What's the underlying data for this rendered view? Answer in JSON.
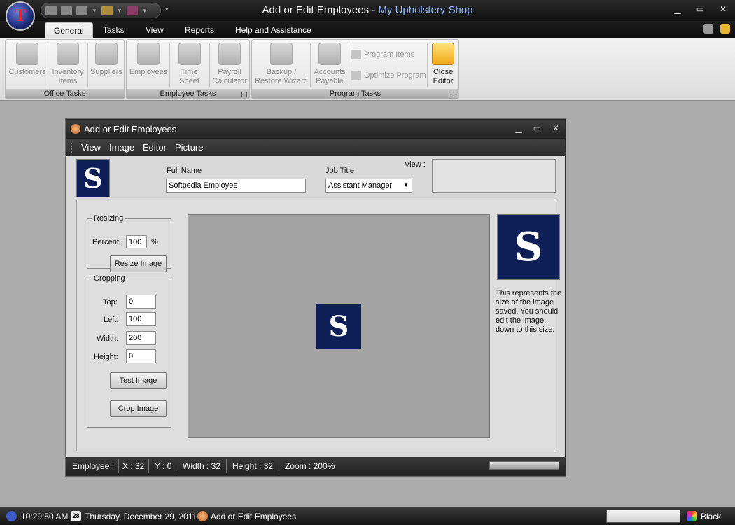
{
  "window": {
    "title_main": "Add or Edit Employees - ",
    "title_app": "My Upholstery Shop",
    "orb_letter": "T"
  },
  "tabs": [
    "General",
    "Tasks",
    "View",
    "Reports",
    "Help and Assistance"
  ],
  "ribbon": {
    "office_tasks": {
      "label": "Office Tasks",
      "customers": "Customers",
      "inventory_l1": "Inventory",
      "inventory_l2": "Items",
      "suppliers": "Suppliers"
    },
    "employee_tasks": {
      "label": "Employee Tasks",
      "employees": "Employees",
      "time_sheet": "Time Sheet",
      "payroll_l1": "Payroll",
      "payroll_l2": "Calculator"
    },
    "program_tasks": {
      "label": "Program Tasks",
      "backup_l1": "Backup /",
      "backup_l2": "Restore Wizard",
      "accounts_l1": "Accounts",
      "accounts_l2": "Payable",
      "program_items": "Program Items",
      "optimize": "Optimize Program",
      "close_l1": "Close",
      "close_l2": "Editor"
    }
  },
  "child": {
    "title": "Add or Edit Employees",
    "menu": [
      "View",
      "Image",
      "Editor",
      "Picture"
    ],
    "logo_letter": "S",
    "full_name_label": "Full Name",
    "full_name_value": "Softpedia Employee",
    "job_title_label": "Job Title",
    "job_title_value": "Assistant Manager",
    "view_label": "View :",
    "resizing": {
      "legend": "Resizing",
      "percent_label": "Percent:",
      "percent_value": "100",
      "percent_unit": "%",
      "resize_button": "Resize Image"
    },
    "cropping": {
      "legend": "Cropping",
      "top_label": "Top:",
      "top_value": "0",
      "left_label": "Left:",
      "left_value": "100",
      "width_label": "Width:",
      "width_value": "200",
      "height_label": "Height:",
      "height_value": "0",
      "test_button": "Test Image",
      "crop_button": "Crop Image"
    },
    "note": "This represents the size of the image saved. You should edit the  image, down to this size.",
    "status": {
      "employee": "Employee :",
      "x": "X : 32",
      "y": "Y : 0",
      "width": "Width : 32",
      "height": "Height : 32",
      "zoom": "Zoom : 200%"
    }
  },
  "taskbar": {
    "time": "10:29:50 AM",
    "calendar_day": "28",
    "date": "Thursday, December 29, 2011",
    "task": "Add or Edit Employees",
    "theme": "Black"
  }
}
